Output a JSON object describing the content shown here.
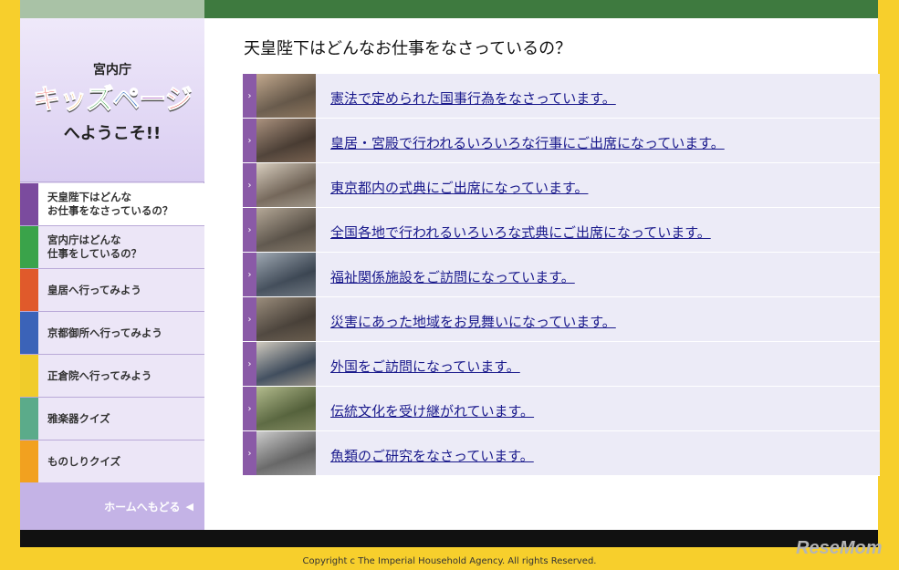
{
  "sidebar": {
    "logo": {
      "org": "宮内庁",
      "chars": [
        {
          "t": "キ",
          "c": "#e8342c"
        },
        {
          "t": "ッ",
          "c": "#f39a1d"
        },
        {
          "t": "ズ",
          "c": "#2f9a3c"
        },
        {
          "t": "ペ",
          "c": "#2f6cc4"
        },
        {
          "t": "ー",
          "c": "#9b3bb6"
        },
        {
          "t": "ジ",
          "c": "#e8342c"
        }
      ],
      "welcome": "へようこそ!!"
    },
    "nav": [
      {
        "label": "天皇陛下はどんな\nお仕事をなさっているの？",
        "color": "#7b4b9e",
        "active": true
      },
      {
        "label": "宮内庁はどんな\n仕事をしているの？",
        "color": "#3aa34a"
      },
      {
        "label": "皇居へ行ってみよう",
        "color": "#e05a2b"
      },
      {
        "label": "京都御所へ行ってみよう",
        "color": "#3b63b8"
      },
      {
        "label": "正倉院へ行ってみよう",
        "color": "#f0cc2a"
      },
      {
        "label": "雅楽器クイズ",
        "color": "#5bab8a"
      },
      {
        "label": "ものしりクイズ",
        "color": "#f2a11f"
      }
    ],
    "home_label": "ホームへもどる",
    "home_icon": "arrow-left-icon"
  },
  "main": {
    "title": "天皇陛下はどんなお仕事をなさっているの？",
    "items": [
      {
        "text": "憲法で定められた国事行為をなさっています。",
        "thumb": [
          "#6b5a48",
          "#b89a7a"
        ]
      },
      {
        "text": "皇居・宮殿で行われるいろいろな行事にご出席になっています。",
        "thumb": [
          "#4a3a2e",
          "#9c7f68"
        ]
      },
      {
        "text": "東京都内の式典にご出席になっています。",
        "thumb": [
          "#7a6a5a",
          "#d2c6b4"
        ]
      },
      {
        "text": "全国各地で行われるいろいろな式典にご出席になっています。",
        "thumb": [
          "#5e5448",
          "#a99a86"
        ]
      },
      {
        "text": "福祉関係施設をご訪問になっています。",
        "thumb": [
          "#3d4a5a",
          "#8f9aa6"
        ]
      },
      {
        "text": "災害にあった地域をお見舞いになっています。",
        "thumb": [
          "#4a4036",
          "#8a7a66"
        ]
      },
      {
        "text": "外国をご訪問になっています。",
        "thumb": [
          "#3a4a5e",
          "#c9c2b4"
        ]
      },
      {
        "text": "伝統文化を受け継がれています。",
        "thumb": [
          "#5a6a3a",
          "#a6b07a"
        ]
      },
      {
        "text": "魚類のご研究をなさっています。",
        "thumb": [
          "#6a6a6a",
          "#c4c4c4"
        ]
      }
    ]
  },
  "footer": {
    "copyright": "Copyright c The Imperial Household Agency. All rights Reserved.",
    "watermark": "ReseMom"
  }
}
